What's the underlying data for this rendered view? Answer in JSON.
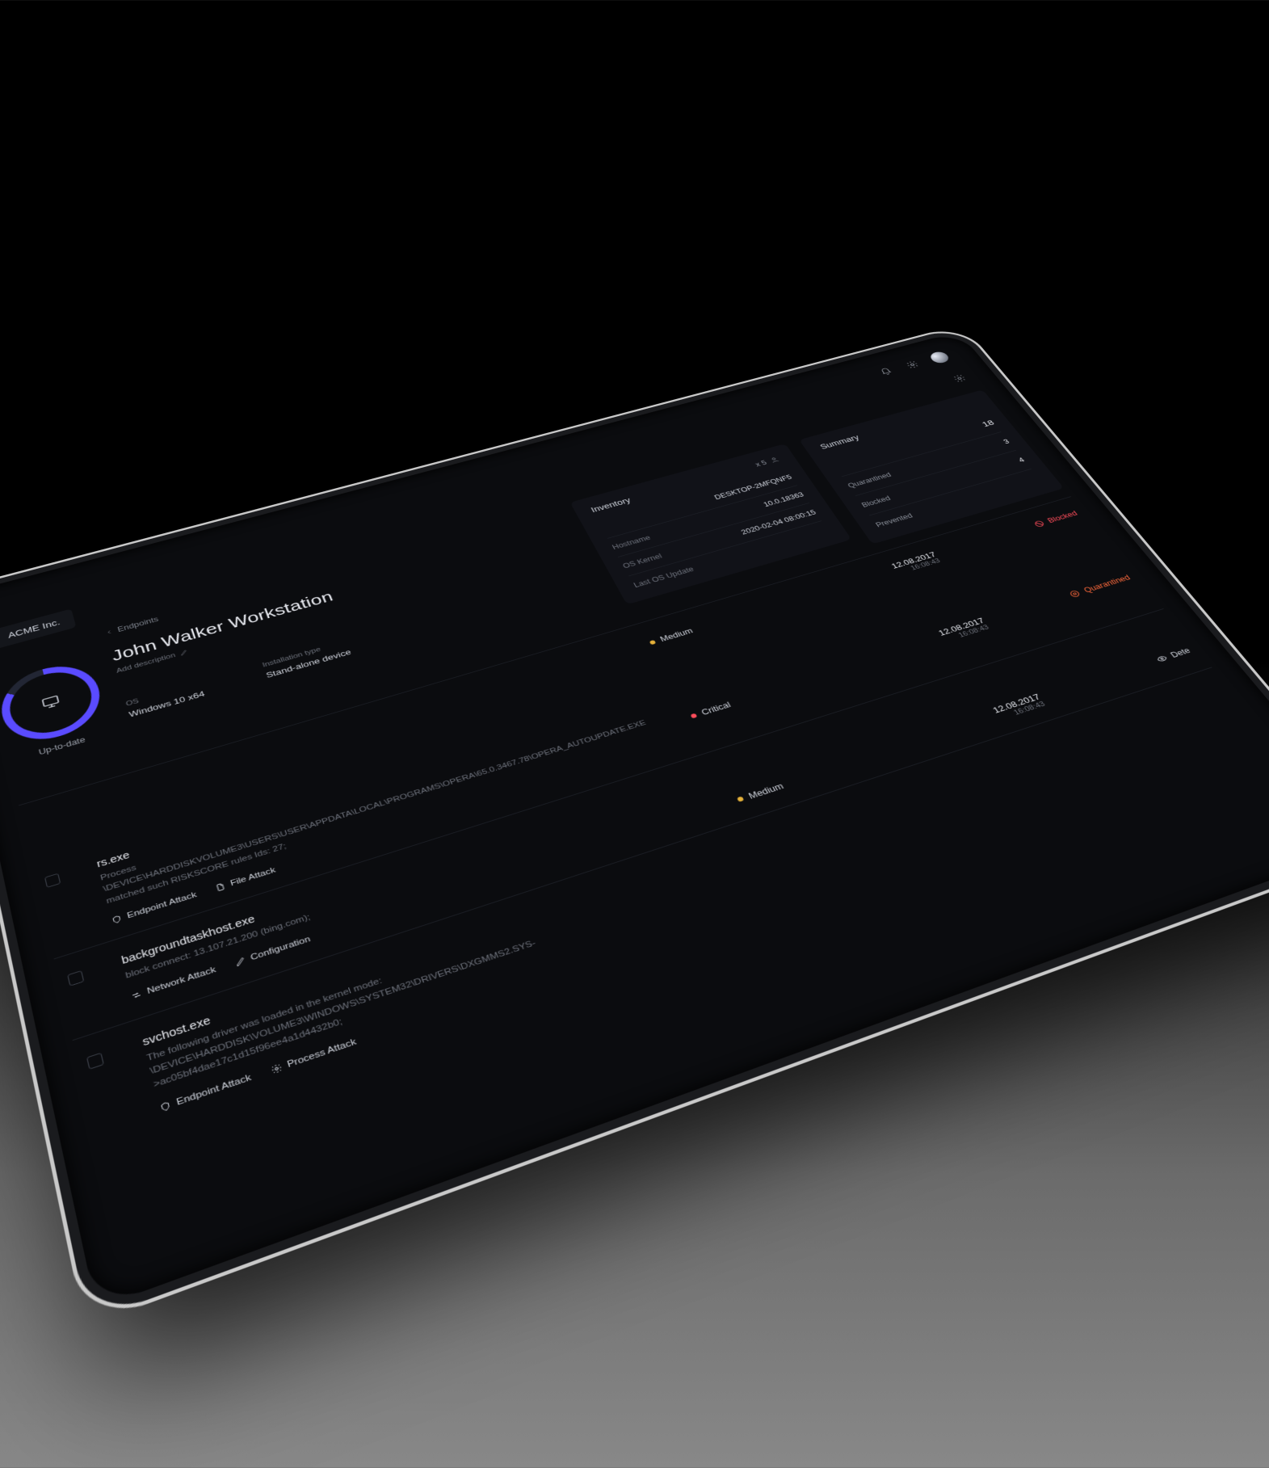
{
  "header": {
    "company": "ACME Inc."
  },
  "breadcrumb": {
    "label": "Endpoints"
  },
  "workstation": {
    "title": "John Walker Workstation",
    "add_description": "Add description",
    "status_label": "Up-to-date",
    "os_label": "OS",
    "os_value": "Windows 10 x64",
    "install_label": "Installation type",
    "install_value": "Stand-alone device"
  },
  "inventory": {
    "title": "Inventory",
    "users_count": "x 5",
    "rows": [
      {
        "key": "",
        "val": "DESKTOP-2MFQNF5"
      },
      {
        "key": "Hostname",
        "val": "10.0.18363"
      },
      {
        "key": "OS Kernel",
        "val": "2020-02-04 08:00:15"
      },
      {
        "key": "Last OS Update",
        "val": ""
      }
    ]
  },
  "summary": {
    "title": "Summary",
    "rows": [
      {
        "key": "",
        "val": "18"
      },
      {
        "key": "Quarantined",
        "val": "3"
      },
      {
        "key": "Blocked",
        "val": "4"
      },
      {
        "key": "Prevented",
        "val": ""
      }
    ]
  },
  "top_row": {
    "severity": "Medium",
    "date": "12.08.2017",
    "time": "16:08:43",
    "status": "Blocked"
  },
  "threats": [
    {
      "name": "rs.exe",
      "desc": "Process \\DEVICE\\HARDDISKVOLUME3\\USERS\\USER\\APPDATA\\LOCAL\\PROGRAMS\\OPERA\\65.0.3467.78\\OPERA_AUTOUPDATE.EXE matched such RISKSCORE rules Ids: 27;",
      "tags": [
        "Endpoint Attack",
        "File Attack"
      ],
      "severity": "Critical",
      "date": "12.08.2017",
      "time": "16:08:43",
      "status": "Quarantined"
    },
    {
      "name": "backgroundtaskhost.exe",
      "desc": "block connect: 13.107.21.200 (bing.com);",
      "tags": [
        "Network Attack",
        "Configuration"
      ],
      "severity": "Medium",
      "date": "12.08.2017",
      "time": "16:08:43",
      "status": "Dete"
    },
    {
      "name": "svchost.exe",
      "desc": "The following driver was loaded in the kernel mode: \\DEVICE\\HARDDISK\\VOLUME3\\WINDOWS\\SYSTEM32\\DRIVERS\\DXGMMS2.SYS->ac05bf4dae17c1d15f96ee4a1d4432b0;",
      "tags": [
        "Endpoint Attack",
        "Process Attack"
      ],
      "severity": "",
      "date": "",
      "time": "",
      "status": ""
    }
  ]
}
